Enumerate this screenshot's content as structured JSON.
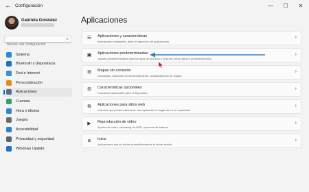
{
  "window": {
    "title": "Configuración",
    "back_glyph": "←",
    "controls": {
      "minimize": "—",
      "maximize": "☐",
      "close": "✕"
    }
  },
  "user": {
    "name": "Gabriela Gonzalez"
  },
  "search": {
    "placeholder": "Buscar una configuración"
  },
  "nav": [
    {
      "label": "Sistema",
      "icon": "system-icon",
      "color": "#2b88d8"
    },
    {
      "label": "Bluetooth y dispositivos",
      "icon": "bluetooth-icon",
      "color": "#1a73c9"
    },
    {
      "label": "Red e Internet",
      "icon": "network-icon",
      "color": "#3a8fd9"
    },
    {
      "label": "Personalización",
      "icon": "brush-icon",
      "color": "#e08a1e"
    },
    {
      "label": "Aplicaciones",
      "icon": "apps-icon",
      "color": "#5a6b8c",
      "active": true
    },
    {
      "label": "Cuentas",
      "icon": "accounts-icon",
      "color": "#2fa36b"
    },
    {
      "label": "Hora e idioma",
      "icon": "time-language-icon",
      "color": "#2b88d8"
    },
    {
      "label": "Juegos",
      "icon": "gaming-icon",
      "color": "#6b6b6b"
    },
    {
      "label": "Accesibilidad",
      "icon": "accessibility-icon",
      "color": "#2b7fd0"
    },
    {
      "label": "Privacidad y seguridad",
      "icon": "shield-icon",
      "color": "#5b6470"
    },
    {
      "label": "Windows Update",
      "icon": "windows-update-icon",
      "color": "#1a73c9"
    }
  ],
  "main": {
    "title": "Aplicaciones",
    "cards": [
      {
        "title": "Aplicaciones y características",
        "subtitle": "Aplicaciones instaladas, alias de ejecución de aplicaciones",
        "icon": "apps-features-icon",
        "glyph": "☰"
      },
      {
        "title": "Aplicaciones predeterminadas",
        "subtitle": "Valores predeterminados para los tipos de archivos y vínculos, otros valores predeterminados",
        "icon": "default-apps-icon",
        "glyph": "▣"
      },
      {
        "title": "Mapas sin conexión",
        "subtitle": "Descargas, ubicación de almacenamiento, actualizaciones de mapas",
        "icon": "offline-maps-icon",
        "glyph": "⊞"
      },
      {
        "title": "Características opcionales",
        "subtitle": "Funciones adicionales para el dispositivo",
        "icon": "optional-features-icon",
        "glyph": "⊞"
      },
      {
        "title": "Aplicaciones para sitios web",
        "subtitle": "Vínculos que pueden abrirse en una aplicación en lugar de en un explorador",
        "icon": "websites-apps-icon",
        "glyph": "⧉"
      },
      {
        "title": "Reproducción de vídeo",
        "subtitle": "Ajustes de vídeo, streaming de HDR, opciones de batería",
        "icon": "video-playback-icon",
        "glyph": "▶"
      },
      {
        "title": "Inicio",
        "subtitle": "Aplicaciones que se inician automáticamente al iniciar sesión",
        "icon": "startup-icon",
        "glyph": "⧈"
      }
    ],
    "chevron": "›"
  },
  "colors": {
    "accent": "#0067c0",
    "annotation_arrow": "#2e7fc4",
    "cursor": "#c0143c"
  }
}
